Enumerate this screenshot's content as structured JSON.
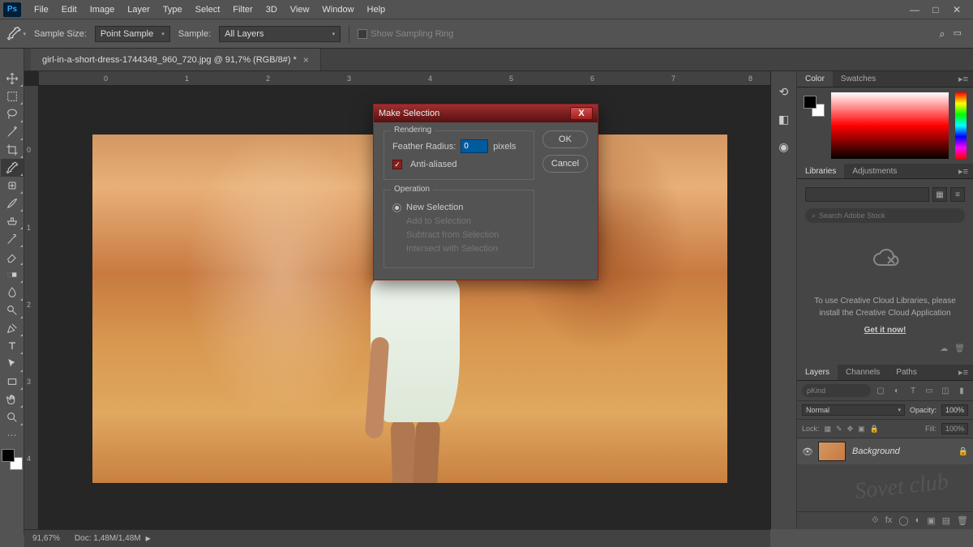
{
  "menubar": {
    "logo": "Ps",
    "items": [
      "File",
      "Edit",
      "Image",
      "Layer",
      "Type",
      "Select",
      "Filter",
      "3D",
      "View",
      "Window",
      "Help"
    ]
  },
  "optbar": {
    "sample_size_label": "Sample Size:",
    "sample_size_value": "Point Sample",
    "sample_label": "Sample:",
    "sample_value": "All Layers",
    "show_ring": "Show Sampling Ring"
  },
  "doctab": {
    "title": "girl-in-a-short-dress-1744349_960_720.jpg @ 91,7% (RGB/8#) *"
  },
  "statusbar": {
    "zoom": "91,67%",
    "docinfo": "Doc: 1,48M/1,48M"
  },
  "dialog": {
    "title": "Make Selection",
    "rendering": "Rendering",
    "feather_label": "Feather Radius:",
    "feather_value": "0",
    "pixels": "pixels",
    "aa": "Anti-aliased",
    "operation": "Operation",
    "op_new": "New Selection",
    "op_add": "Add to Selection",
    "op_sub": "Subtract from Selection",
    "op_int": "Intersect with Selection",
    "ok": "OK",
    "cancel": "Cancel"
  },
  "panels": {
    "color_tab": "Color",
    "swatches_tab": "Swatches",
    "libraries_tab": "Libraries",
    "adjustments_tab": "Adjustments",
    "lib_search": "Search Adobe Stock",
    "lib_msg1": "To use Creative Cloud Libraries, please install the Creative Cloud Application",
    "lib_link": "Get it now!",
    "layers_tab": "Layers",
    "channels_tab": "Channels",
    "paths_tab": "Paths",
    "layer_kind": "Kind",
    "blend_mode": "Normal",
    "opacity_label": "Opacity:",
    "opacity_value": "100%",
    "lock_label": "Lock:",
    "fill_label": "Fill:",
    "fill_value": "100%",
    "layer_name": "Background"
  },
  "watermark": "Sovet club"
}
